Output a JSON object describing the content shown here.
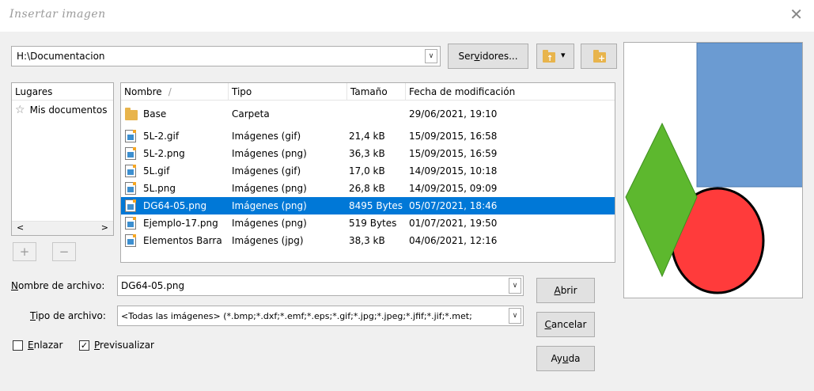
{
  "window": {
    "title": "Insertar imagen",
    "close_glyph": "✕"
  },
  "path": {
    "value": "H:\\Documentacion"
  },
  "toolbar": {
    "servers_label": "Servidores...",
    "up_label": "▾"
  },
  "places": {
    "header": "Lugares",
    "items": [
      {
        "label": "Mis documentos",
        "icon": "star-icon"
      }
    ],
    "add_label": "+",
    "remove_label": "−"
  },
  "files": {
    "columns": {
      "name": "Nombre",
      "type": "Tipo",
      "size": "Tamaño",
      "date": "Fecha de modificación"
    },
    "sort_mark": "/",
    "rows": [
      {
        "name": "Base",
        "type": "Carpeta",
        "size": "",
        "date": "29/06/2021, 19:10",
        "icon": "folder-icon"
      },
      {
        "name": "5L-2.gif",
        "type": "Imágenes (gif)",
        "size": "21,4 kB",
        "date": "15/09/2015, 16:58",
        "icon": "image-file-icon"
      },
      {
        "name": "5L-2.png",
        "type": "Imágenes (png)",
        "size": "36,3 kB",
        "date": "15/09/2015, 16:59",
        "icon": "image-file-icon"
      },
      {
        "name": "5L.gif",
        "type": "Imágenes (gif)",
        "size": "17,0 kB",
        "date": "14/09/2015, 10:18",
        "icon": "image-file-icon"
      },
      {
        "name": "5L.png",
        "type": "Imágenes (png)",
        "size": "26,8 kB",
        "date": "14/09/2015, 09:09",
        "icon": "image-file-icon"
      },
      {
        "name": "DG64-05.png",
        "type": "Imágenes (png)",
        "size": "8495 Bytes",
        "date": "05/07/2021, 18:46",
        "icon": "image-file-icon",
        "selected": true
      },
      {
        "name": "Ejemplo-17.png",
        "type": "Imágenes (png)",
        "size": "519 Bytes",
        "date": "01/07/2021, 19:50",
        "icon": "image-file-icon"
      },
      {
        "name": "Elementos Barra",
        "type": "Imágenes (jpg)",
        "size": "38,3 kB",
        "date": "04/06/2021, 12:16",
        "icon": "image-file-icon"
      }
    ]
  },
  "filename": {
    "label": "Nombre de archivo:",
    "value": "DG64-05.png"
  },
  "filetype": {
    "label": "Tipo de archivo:",
    "value": "<Todas las imágenes> (*.bmp;*.dxf;*.emf;*.eps;*.gif;*.jpg;*.jpeg;*.jfif;*.jif;*.met;"
  },
  "options": {
    "link_label": "Enlazar",
    "link_checked": false,
    "preview_label": "Previsualizar",
    "preview_checked": true
  },
  "buttons": {
    "open": "Abrir",
    "cancel": "Cancelar",
    "help": "Ayuda"
  },
  "preview": {
    "square_color": "#6b9bd2",
    "circle_color": "#ff3b3b",
    "diamond_color": "#5db82e"
  },
  "colors": {
    "selection": "#0078d7",
    "folder": "#e8b44c"
  }
}
